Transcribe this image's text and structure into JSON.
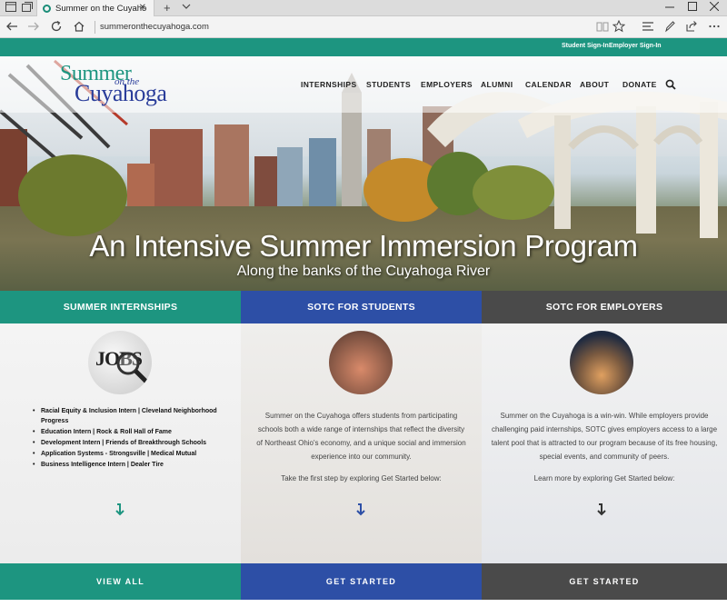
{
  "browser": {
    "tab_title": "Summer on the Cuyaho",
    "tab_close": "✕",
    "new_tab": "+",
    "url": "summeronthecuyahoga.com"
  },
  "site": {
    "top_links": [
      "Student Sign-In",
      "Employer Sign-In"
    ],
    "logo": {
      "line1": "Summer",
      "line2": "on the",
      "line3": "Cuyahoga"
    },
    "menu": [
      "INTERNSHIPS",
      "STUDENTS",
      "EMPLOYERS",
      "ALUMNI",
      "CALENDAR",
      "ABOUT",
      "DONATE"
    ],
    "hero": {
      "title": "An Intensive Summer Immersion Program",
      "subtitle": "Along the banks of the Cuyahoga River"
    },
    "columns": [
      {
        "heading": "SUMMER INTERNSHIPS",
        "image_label": "JOBS",
        "list": [
          "Racial Equity & Inclusion Intern | Cleveland Neighborhood Progress",
          "Education Intern | Rock & Roll Hall of Fame",
          "Development Intern | Friends of Breakthrough Schools",
          "Application Systems - Strongsville | Medical Mutual",
          "Business Intelligence Intern | Dealer Tire"
        ],
        "button": "VIEW ALL",
        "color": "#1d9580"
      },
      {
        "heading": "SOTC FOR STUDENTS",
        "text": "Summer on the Cuyahoga offers students from participating schools both a wide range of internships that reflect the diversity of Northeast Ohio's economy, and a unique social and immersion experience into our community.",
        "cta": "Take the first step by exploring Get Started below:",
        "button": "GET STARTED",
        "color": "#2d4fa6"
      },
      {
        "heading": "SOTC FOR EMPLOYERS",
        "text": "Summer on the Cuyahoga is a win-win. While employers provide challenging paid internships, SOTC gives employers access to a large talent pool that is attracted to our program because of its free housing, special events, and community of peers.",
        "cta": "Learn more by exploring Get Started below:",
        "button": "GET STARTED",
        "color": "#4a4a4a"
      }
    ]
  }
}
